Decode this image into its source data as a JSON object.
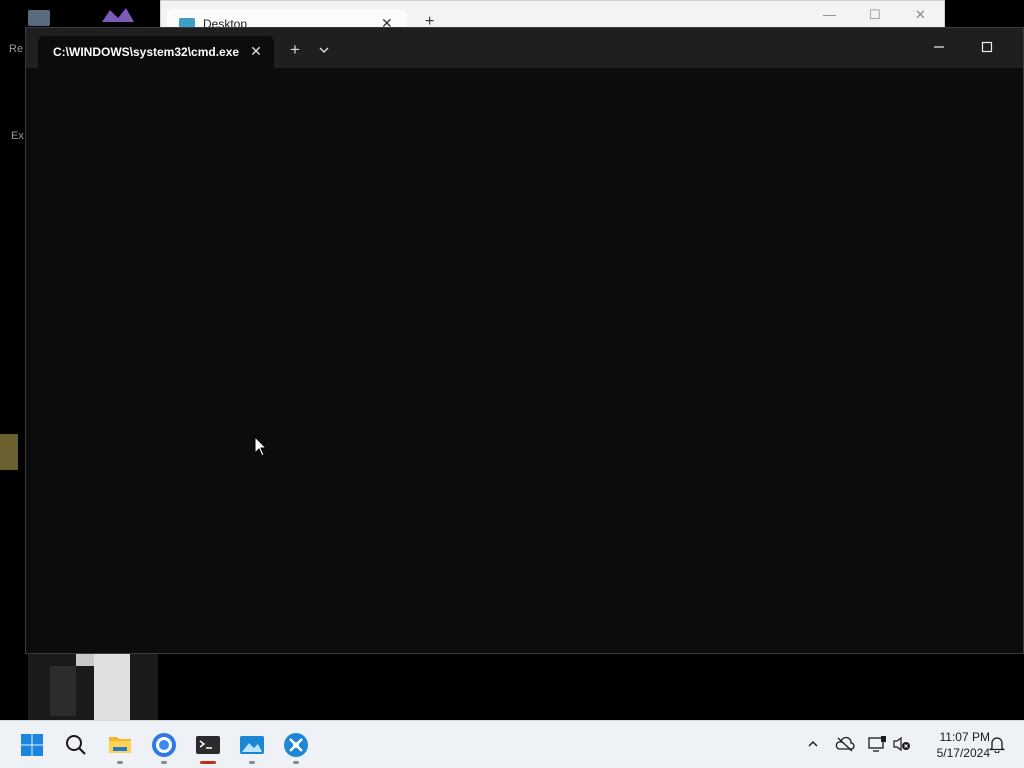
{
  "desktop": {
    "labels": [
      "Re",
      "Ex"
    ]
  },
  "background_window": {
    "tab_title": "Desktop",
    "close_glyph": "✕",
    "new_tab_glyph": "+",
    "minimize_glyph": "—",
    "maximize_glyph": "☐",
    "close_window_glyph": "✕"
  },
  "terminal": {
    "tab_title": "C:\\WINDOWS\\system32\\cmd.exe",
    "close_glyph": "✕",
    "new_tab_glyph": "+",
    "icons": [
      "chevron-down-icon",
      "minimize-icon",
      "maximize-icon"
    ],
    "background_color": "#0c0c0c"
  },
  "taskbar": {
    "apps": [
      {
        "name": "start",
        "icon": "windows-logo-icon"
      },
      {
        "name": "search",
        "icon": "search-icon"
      },
      {
        "name": "file-explorer",
        "icon": "folder-icon"
      },
      {
        "name": "chrome",
        "icon": "chrome-icon"
      },
      {
        "name": "terminal",
        "icon": "terminal-icon",
        "active": true
      },
      {
        "name": "photos",
        "icon": "photos-icon"
      },
      {
        "name": "remote",
        "icon": "app-icon"
      }
    ],
    "tray_icons": [
      "chevron-up-icon",
      "onedrive-offline-icon",
      "network-icon",
      "sound-muted-icon",
      "notification-icon"
    ],
    "clock": {
      "time": "11:07 PM",
      "date": "5/17/2024"
    }
  }
}
